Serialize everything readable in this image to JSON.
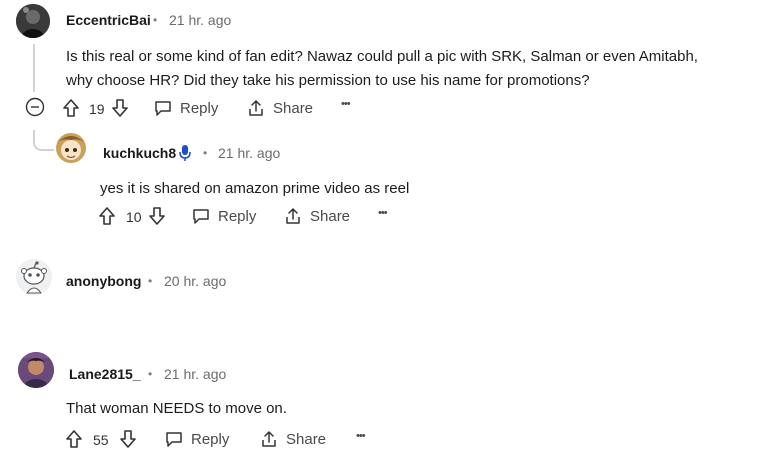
{
  "comments": [
    {
      "username": "EccentricBai",
      "separator": "•",
      "time": "21 hr. ago",
      "body_line1": "Is this real or some kind of fan edit? Nawaz could pull a pic with SRK, Salman or even Amitabh,",
      "body_line2": "why choose HR? Did they take his permission to use his name for promotions?",
      "votes": "19",
      "reply_label": "Reply",
      "share_label": "Share",
      "more_label": "•••"
    },
    {
      "username": "kuchkuch8",
      "separator": "•",
      "time": "21 hr. ago",
      "body": "yes it is shared on amazon prime video as reel",
      "votes": "10",
      "reply_label": "Reply",
      "share_label": "Share",
      "more_label": "•••"
    },
    {
      "username": "anonybong",
      "separator": "•",
      "time": "20 hr. ago"
    },
    {
      "username": "Lane2815_",
      "separator": "•",
      "time": "21 hr. ago",
      "body": "That woman NEEDS to move on.",
      "votes": "55",
      "reply_label": "Reply",
      "share_label": "Share",
      "more_label": "•••"
    }
  ],
  "colors": {
    "text": "#1c1c1c",
    "muted": "#6b6b6b",
    "thread_line": "#d0d3d6",
    "mic_icon": "#1a4fd0"
  }
}
